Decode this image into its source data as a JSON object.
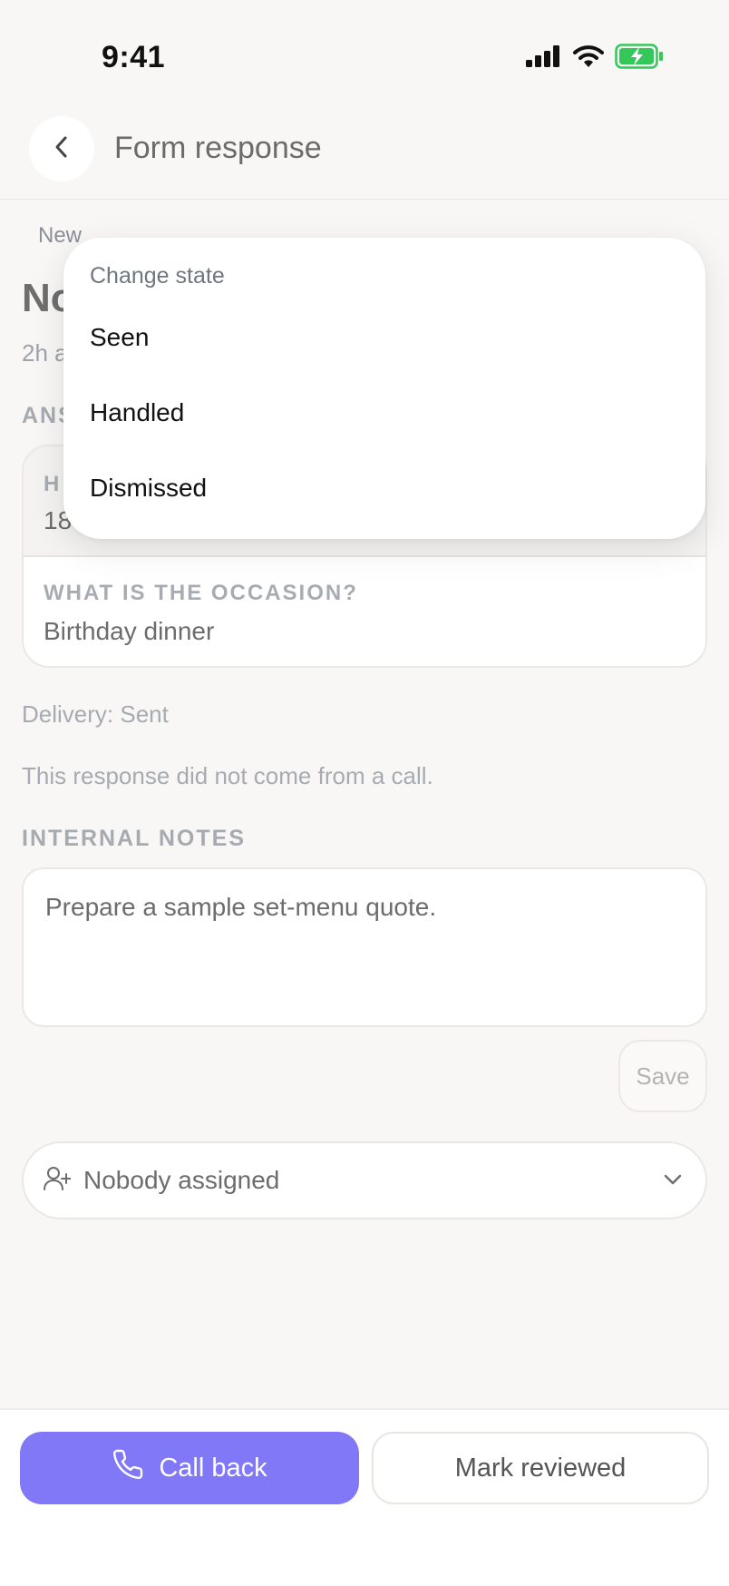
{
  "status_bar": {
    "time": "9:41"
  },
  "header": {
    "title": "Form response"
  },
  "response": {
    "state_badge": "New",
    "name_partial": "No",
    "time_partial": "2h a",
    "answers_label_partial": "ANS"
  },
  "answers": [
    {
      "question_partial": "H",
      "answer_partial": "18"
    },
    {
      "question": "WHAT IS THE OCCASION?",
      "answer": "Birthday dinner"
    }
  ],
  "delivery": "Delivery: Sent",
  "call_note": "This response did not come from a call.",
  "notes": {
    "label": "INTERNAL NOTES",
    "value": "Prepare a sample set-menu quote.",
    "save_label": "Save"
  },
  "assignment": {
    "label": "Nobody assigned",
    "icon": "user-plus-icon"
  },
  "actions": {
    "call_back": "Call back",
    "mark_reviewed": "Mark reviewed"
  },
  "state_menu": {
    "title": "Change state",
    "items": [
      "Seen",
      "Handled",
      "Dismissed"
    ]
  },
  "colors": {
    "accent": "#8078f6",
    "battery": "#34c759",
    "background": "#f9f7f5"
  }
}
